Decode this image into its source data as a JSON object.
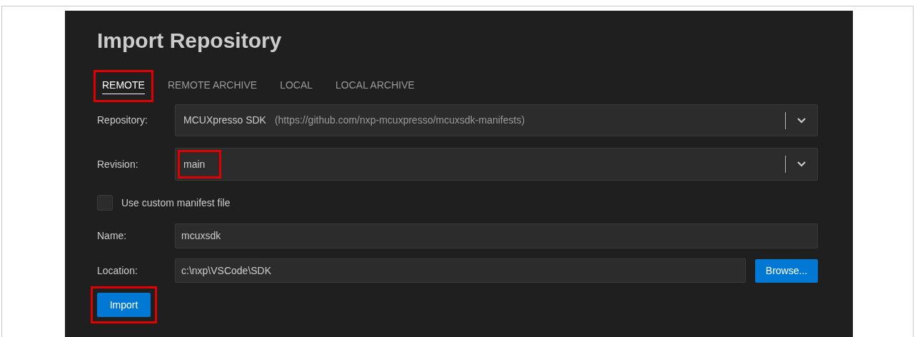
{
  "title": "Import Repository",
  "tabs": [
    {
      "label": "REMOTE",
      "selected": true,
      "highlighted": true
    },
    {
      "label": "REMOTE ARCHIVE",
      "selected": false,
      "highlighted": false
    },
    {
      "label": "LOCAL",
      "selected": false,
      "highlighted": false
    },
    {
      "label": "LOCAL ARCHIVE",
      "selected": false,
      "highlighted": false
    }
  ],
  "repository": {
    "label": "Repository:",
    "value": "MCUXpresso SDK",
    "detail": "(https://github.com/nxp-mcuxpresso/mcuxsdk-manifests)"
  },
  "revision": {
    "label": "Revision:",
    "value": "main",
    "highlighted": true
  },
  "custom_manifest": {
    "label": "Use custom manifest file",
    "checked": false
  },
  "name": {
    "label": "Name:",
    "value": "mcuxsdk"
  },
  "location": {
    "label": "Location:",
    "value": "c:\\nxp\\VSCode\\SDK",
    "button": "Browse..."
  },
  "import_button": {
    "label": "Import",
    "highlighted": true
  }
}
